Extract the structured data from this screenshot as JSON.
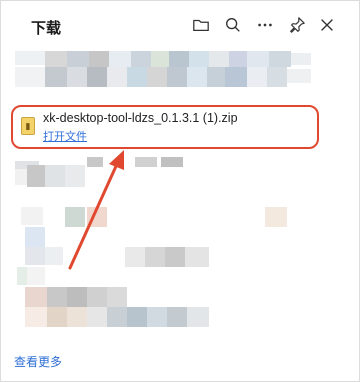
{
  "header": {
    "title": "下载",
    "icons": [
      "folder-icon",
      "search-icon",
      "more-icon",
      "pin-icon",
      "close-icon"
    ]
  },
  "download_item": {
    "file_name": "xk-desktop-tool-ldzs_0.1.3.1 (1).zip",
    "open_link": "打开文件",
    "file_type_icon": "zip-icon"
  },
  "footer": {
    "see_more": "查看更多"
  },
  "colors": {
    "highlight": "#e0482f",
    "link": "#2f6fd6"
  }
}
